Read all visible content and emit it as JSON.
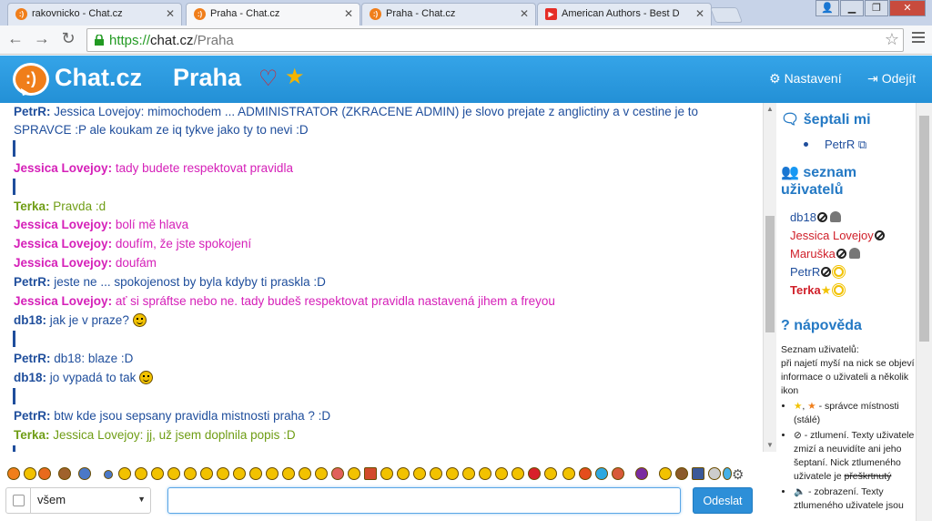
{
  "browser": {
    "tabs": [
      {
        "title": "rakovnicko - Chat.cz",
        "favicon": "chat-favicon"
      },
      {
        "title": "Praha - Chat.cz",
        "favicon": "chat-favicon",
        "active": true
      },
      {
        "title": "Praha - Chat.cz",
        "favicon": "chat-favicon"
      },
      {
        "title": "American Authors - Best D",
        "favicon": "youtube-favicon"
      }
    ],
    "url": {
      "scheme": "https://",
      "host": "chat.cz",
      "path": "/Praha"
    }
  },
  "header": {
    "brand": "Chat.cz",
    "room": "Praha",
    "settings_label": "Nastavení",
    "logout_label": "Odejít",
    "colors": {
      "bar": "#2a9be0",
      "logo": "#f07e1a",
      "heart": "#d8202a",
      "star": "#f4b400"
    }
  },
  "messages": [
    {
      "nick": "PetrR:",
      "text": "Jessica Lovejoy: mimochodem ... ADMINISTRATOR (ZKRACENE ADMIN) je slovo prejate z anglictiny a v cestine je to",
      "color": "blue"
    },
    {
      "nick": "",
      "text": "SPRAVCE :P ale koukam ze iq tykve jako ty to nevi :D",
      "color": "blue"
    },
    {
      "nick": "Jessica Lovejoy:",
      "text": "tady budete respektovat pravidla",
      "color": "pink"
    },
    {
      "nick": "Terka:",
      "text": "Pravda :d",
      "color": "green"
    },
    {
      "nick": "Jessica Lovejoy:",
      "text": "bolí mě hlava",
      "color": "pink"
    },
    {
      "nick": "Jessica Lovejoy:",
      "text": "doufím, že jste spokojení",
      "color": "pink"
    },
    {
      "nick": "Jessica Lovejoy:",
      "text": "doufám",
      "color": "pink"
    },
    {
      "nick": "PetrR:",
      "text": "jeste ne ... spokojenost by byla kdyby ti praskla :D",
      "color": "blue"
    },
    {
      "nick": "Jessica Lovejoy:",
      "text": "ať si spráftse nebo ne. tady budeš respektovat pravidla nastavená jihem a freyou",
      "color": "pink"
    },
    {
      "nick": "db18:",
      "text": "jak je v praze?",
      "color": "blue",
      "smiley": true
    },
    {
      "nick": "PetrR:",
      "text": "db18: blaze :D",
      "color": "blue"
    },
    {
      "nick": "db18:",
      "text": "jo vypadá to tak",
      "color": "blue",
      "smiley": true
    },
    {
      "nick": "PetrR:",
      "text": "btw kde jsou sepsany pravidla mistnosti praha ? :D",
      "color": "blue"
    },
    {
      "nick": "Terka:",
      "text": "Jessica Lovejoy: jj, už jsem doplnila popis :D",
      "color": "green"
    }
  ],
  "sidebar": {
    "whispered_title": "šeptali mi",
    "whispered_user": "PetrR",
    "users_title_1": "seznam",
    "users_title_2": "uživatelů",
    "users": [
      {
        "nick": "db18",
        "color": "#1f4e9c",
        "icons": [
          "ban-icon",
          "spy-icon"
        ]
      },
      {
        "nick": "Jessica Lovejoy",
        "color": "#d0202a",
        "icons": [
          "ban-icon"
        ]
      },
      {
        "nick": "Maruška",
        "color": "#d0202a",
        "icons": [
          "ban-icon",
          "spy-icon"
        ]
      },
      {
        "nick": "PetrR",
        "color": "#1f4e9c",
        "icons": [
          "ban-icon",
          "sun-icon"
        ]
      },
      {
        "nick": "Terka",
        "color": "#d0202a",
        "bold": true,
        "icons": [
          "star-icon",
          "sun-icon"
        ]
      }
    ],
    "help_title": "nápověda",
    "help_intro_1": "Seznam uživatelů:",
    "help_intro_2": "při najetí myší na nick se objeví informace o uživateli a několik ikon",
    "help_item_1": "- správce místnosti (stálé)",
    "help_item_2a": "- ztlumení. Texty uživatele zmizí a neuvidíte ani jeho šeptaní. Nick ztlumeného uživatele je",
    "help_item_2b": "přeškrtnutý",
    "help_item_3": "- zobrazení. Texty ztlumeného uživatele jsou"
  },
  "composer": {
    "target": "všem",
    "send_label": "Odeslat",
    "placeholder": ""
  }
}
